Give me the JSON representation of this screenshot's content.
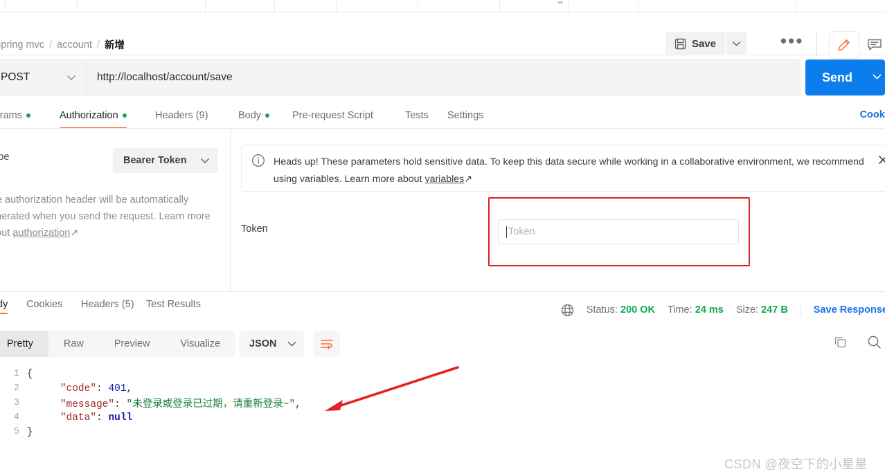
{
  "tabstrip": {
    "tabs": [
      "",
      "",
      "",
      "",
      "",
      "",
      "",
      "",
      "",
      ""
    ]
  },
  "breadcrumb": {
    "root": "spring mvc",
    "sep": "/",
    "folder": "account",
    "current": "新增"
  },
  "toolbar": {
    "save_label": "Save",
    "save_caret": "chevron-down",
    "more_label": "●●●",
    "pencil_icon": "pencil-icon",
    "comment_icon": "comment-icon"
  },
  "request": {
    "method": "POST",
    "url": "http://localhost/account/save",
    "send_label": "Send",
    "tabs": [
      {
        "label": "Params",
        "dot": true,
        "selected": false
      },
      {
        "label": "Authorization",
        "dot": true,
        "selected": true
      },
      {
        "label": "Headers (9)",
        "dot": false,
        "selected": false
      },
      {
        "label": "Body",
        "dot": true,
        "selected": false
      },
      {
        "label": "Pre-request Script",
        "dot": false,
        "selected": false
      },
      {
        "label": "Tests",
        "dot": false,
        "selected": false
      },
      {
        "label": "Settings",
        "dot": false,
        "selected": false
      }
    ],
    "cookies_link": "Cookies"
  },
  "auth": {
    "type_label": "Type",
    "type_value": "Bearer Token",
    "description_1": "The authorization header will be automatically generated when you send the request. Learn more about ",
    "description_link": "authorization",
    "description_arrow": "↗",
    "banner_text": "Heads up! These parameters hold sensitive data. To keep this data secure while working in a collaborative environment, we recommend using variables. Learn more about ",
    "banner_link": "variables",
    "banner_arrow": "↗",
    "banner_close": "close-icon",
    "token_label": "Token",
    "token_value": "",
    "token_placeholder": "Token"
  },
  "response": {
    "tabs": [
      {
        "label": "dy",
        "selected": true
      },
      {
        "label": "Cookies",
        "selected": false
      },
      {
        "label": "Headers (5)",
        "selected": false
      },
      {
        "label": "Test Results",
        "selected": false
      }
    ],
    "status_label": "Status:",
    "status_value": "200 OK",
    "time_label": "Time:",
    "time_value": "24 ms",
    "size_label": "Size:",
    "size_value": "247 B",
    "save_response": "Save Response",
    "view_tabs": [
      {
        "label": "Pretty",
        "selected": true
      },
      {
        "label": "Raw",
        "selected": false
      },
      {
        "label": "Preview",
        "selected": false
      },
      {
        "label": "Visualize",
        "selected": false
      }
    ],
    "format": "JSON",
    "wrap_icon": "wrap-lines-icon",
    "copy_icon": "copy-icon",
    "search_icon": "search-icon",
    "body_lines": [
      {
        "n": "1",
        "fold": "{",
        "indent": 0,
        "key": "",
        "value": "",
        "type": "open"
      },
      {
        "n": "2",
        "fold": "",
        "indent": 1,
        "key": "\"code\"",
        "value": "401",
        "type": "number",
        "comma": true
      },
      {
        "n": "3",
        "fold": "",
        "indent": 1,
        "key": "\"message\"",
        "value": "\"未登录或登录已过期，请重新登录~\"",
        "type": "string",
        "comma": true
      },
      {
        "n": "4",
        "fold": "",
        "indent": 1,
        "key": "\"data\"",
        "value": "null",
        "type": "null",
        "comma": false
      },
      {
        "n": "5",
        "fold": "}",
        "indent": 0,
        "key": "",
        "value": "",
        "type": "close"
      }
    ]
  },
  "annotations": {
    "red_box": "#e02020",
    "red_arrow": "#e52121",
    "watermark": "CSDN @夜空下的小星星"
  },
  "colors": {
    "accent_orange": "#ff6c37",
    "link_blue": "#1a73e8",
    "send_blue": "#0b7ded",
    "status_green": "#10a84a"
  }
}
